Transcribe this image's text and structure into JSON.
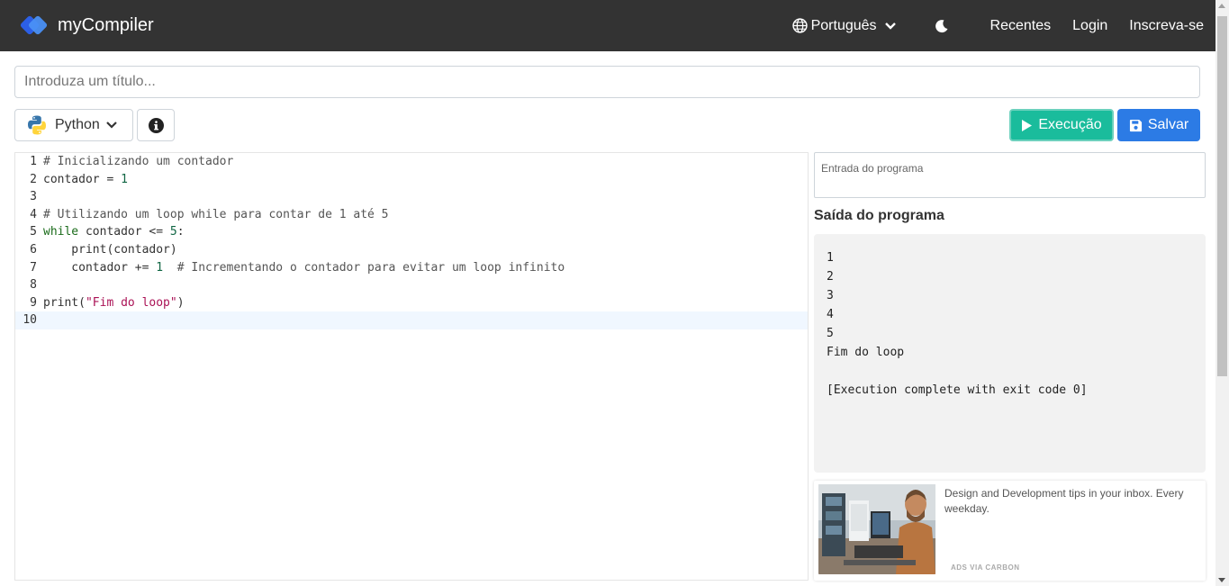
{
  "navbar": {
    "brand": "myCompiler",
    "language": "Português",
    "links": [
      "Recentes",
      "Login",
      "Inscreva-se"
    ],
    "bg_color": "#333333"
  },
  "title_input": {
    "placeholder": "Introduza um título..."
  },
  "toolbar": {
    "language_label": "Python",
    "run_label": "Execução",
    "save_label": "Salvar",
    "run_color": "#1abc9c",
    "save_color": "#2c7be5"
  },
  "editor": {
    "active_line": 10,
    "lines": [
      {
        "n": "1",
        "text": "# Inicializando um contador"
      },
      {
        "n": "2",
        "text": "contador = 1"
      },
      {
        "n": "3",
        "text": ""
      },
      {
        "n": "4",
        "text": "# Utilizando um loop while para contar de 1 até 5"
      },
      {
        "n": "5",
        "text": "while contador <= 5:"
      },
      {
        "n": "6",
        "text": "    print(contador)"
      },
      {
        "n": "7",
        "text": "    contador += 1  # Incrementando o contador para evitar um loop infinito"
      },
      {
        "n": "8",
        "text": ""
      },
      {
        "n": "9",
        "text": "print(\"Fim do loop\")"
      },
      {
        "n": "10",
        "text": ""
      }
    ]
  },
  "program_input": {
    "placeholder": "Entrada do programa"
  },
  "output": {
    "title": "Saída do programa",
    "lines": [
      "1",
      "2",
      "3",
      "4",
      "5",
      "Fim do loop",
      "",
      "[Execution complete with exit code 0]"
    ]
  },
  "ad": {
    "text": "Design and Development tips in your inbox. Every weekday.",
    "via": "ADS VIA CARBON"
  }
}
